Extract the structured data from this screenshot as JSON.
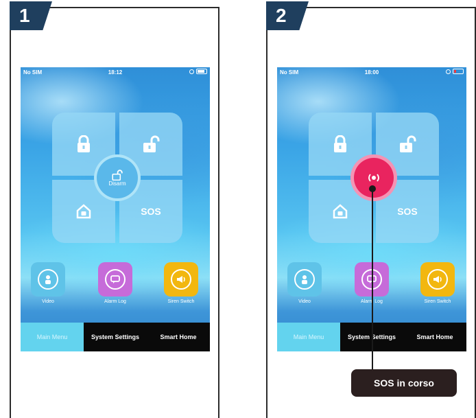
{
  "panels": [
    {
      "step": "1",
      "status": {
        "carrier": "No SIM",
        "time": "18:12"
      },
      "pad": {
        "arm_icon": "lock-closed-icon",
        "disarm_icon": "lock-open-icon",
        "home_icon": "home-icon",
        "sos_label": "SOS",
        "center_label": "Disarm",
        "center_icon": "lock-open-icon"
      },
      "apps": [
        {
          "label": "Video",
          "icon": "video-icon",
          "color": "#5fc3e8"
        },
        {
          "label": "Alarm Log",
          "icon": "alarm-log-icon",
          "color": "#c66bd9"
        },
        {
          "label": "Siren Switch",
          "icon": "siren-icon",
          "color": "#f2b70f"
        }
      ],
      "tabs": [
        "Main Menu",
        "System Settings",
        "Smart Home"
      ]
    },
    {
      "step": "2",
      "status": {
        "carrier": "No SIM",
        "time": "18:00"
      },
      "pad": {
        "arm_icon": "lock-closed-icon",
        "disarm_icon": "lock-open-icon",
        "home_icon": "home-icon",
        "sos_label": "SOS",
        "center_icon": "sos-broadcast-icon"
      },
      "apps": [
        {
          "label": "Video",
          "icon": "video-icon",
          "color": "#5fc3e8"
        },
        {
          "label": "Alarm Log",
          "icon": "alarm-log-icon",
          "color": "#c66bd9"
        },
        {
          "label": "Siren Switch",
          "icon": "siren-icon",
          "color": "#f2b70f"
        }
      ],
      "tabs": [
        "Main Menu",
        "System Settings",
        "Smart Home"
      ],
      "callout": "SOS in corso"
    }
  ],
  "colors": {
    "badge": "#1f3f5e",
    "sos_active": "#e9245f",
    "tab_active": "#63d3ee"
  }
}
